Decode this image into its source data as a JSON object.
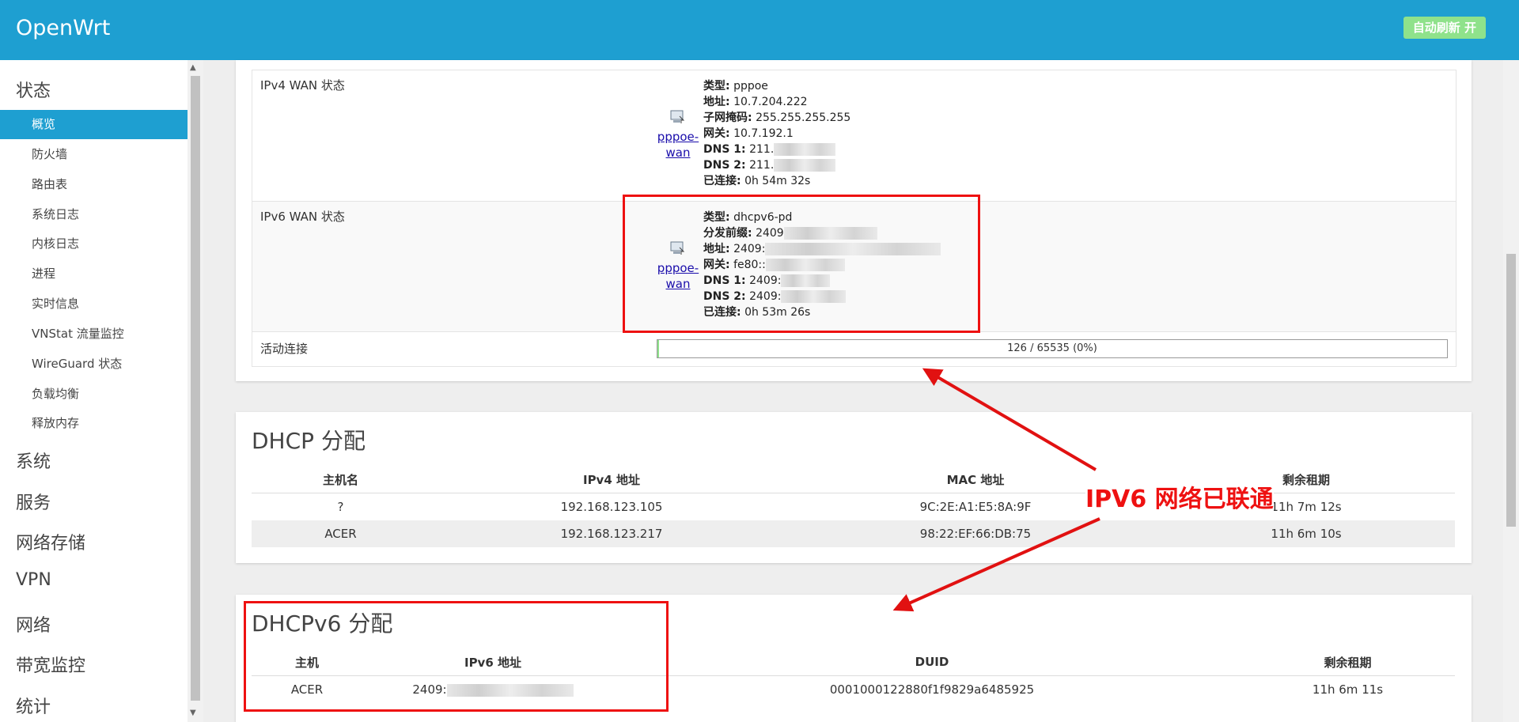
{
  "header": {
    "brand": "OpenWrt",
    "refresh_label": "自动刷新 开"
  },
  "sidebar": {
    "status_label": "状态",
    "status_items": [
      {
        "label": "概览",
        "active": true
      },
      {
        "label": "防火墙"
      },
      {
        "label": "路由表"
      },
      {
        "label": "系统日志"
      },
      {
        "label": "内核日志"
      },
      {
        "label": "进程"
      },
      {
        "label": "实时信息"
      },
      {
        "label": "VNStat 流量监控"
      },
      {
        "label": "WireGuard 状态"
      },
      {
        "label": "负载均衡"
      },
      {
        "label": "释放内存"
      }
    ],
    "categories": [
      "系统",
      "服务",
      "网络存储",
      "VPN",
      "网络",
      "带宽监控",
      "统计"
    ]
  },
  "network": {
    "ipv4_label": "IPv4 WAN 状态",
    "ipv4_iface": "pppoe-wan",
    "ipv4": {
      "type_key": "类型:",
      "type": "pppoe",
      "addr_key": "地址:",
      "addr": "10.7.204.222",
      "mask_key": "子网掩码:",
      "mask": "255.255.255.255",
      "gw_key": "网关:",
      "gw": "10.7.192.1",
      "dns1_key": "DNS 1:",
      "dns1": "211.",
      "dns2_key": "DNS 2:",
      "dns2": "211.",
      "uptime_key": "已连接:",
      "uptime": "0h 54m 32s"
    },
    "ipv6_label": "IPv6 WAN 状态",
    "ipv6_iface": "pppoe-wan",
    "ipv6": {
      "type_key": "类型:",
      "type": "dhcpv6-pd",
      "prefix_key": "分发前缀:",
      "prefix": "2409",
      "addr_key": "地址:",
      "addr": "2409:",
      "gw_key": "网关:",
      "gw": "fe80::",
      "dns1_key": "DNS 1:",
      "dns1": "2409:",
      "dns2_key": "DNS 2:",
      "dns2": "2409:",
      "uptime_key": "已连接:",
      "uptime": "0h 53m 26s"
    },
    "conn_label": "活动连接",
    "conn_text": "126 / 65535 (0%)",
    "conn_fraction": 0.0019
  },
  "dhcp": {
    "title": "DHCP 分配",
    "headers": [
      "主机名",
      "IPv4 地址",
      "MAC 地址",
      "剩余租期"
    ],
    "rows": [
      [
        "?",
        "192.168.123.105",
        "9C:2E:A1:E5:8A:9F",
        "11h 7m 12s"
      ],
      [
        "ACER",
        "192.168.123.217",
        "98:22:EF:66:DB:75",
        "11h 6m 10s"
      ]
    ]
  },
  "dhcpv6": {
    "title": "DHCPv6 分配",
    "headers": [
      "主机",
      "IPv6 地址",
      "DUID",
      "剩余租期"
    ],
    "rows": [
      [
        "ACER",
        "2409:",
        "0001000122880f1f9829a6485925",
        "11h 6m 11s"
      ]
    ]
  },
  "annotation": {
    "text": "IPV6 网络已联通",
    "color": "#e11111"
  }
}
